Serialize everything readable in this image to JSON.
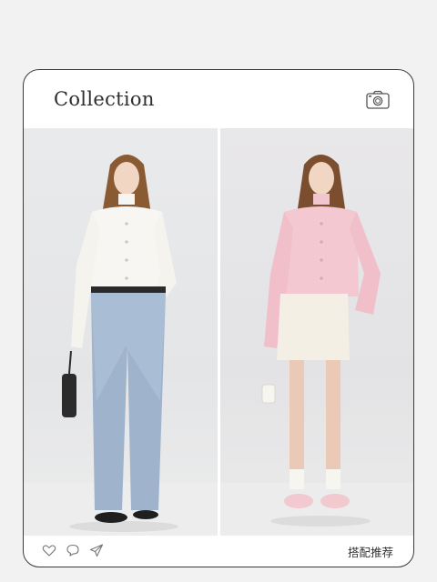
{
  "header": {
    "title": "Collection",
    "camera_icon": "camera-icon"
  },
  "gallery": {
    "photos": [
      {
        "name": "look-white-blouse-jeans",
        "icon": "photo"
      },
      {
        "name": "look-pink-blouse-skirt",
        "icon": "photo"
      }
    ]
  },
  "footer": {
    "icons": [
      "heart-icon",
      "comment-icon",
      "share-icon"
    ],
    "label": "搭配推荐"
  },
  "colors": {
    "background": "#f2f2f2",
    "card": "#ffffff",
    "border": "#3a3a3a",
    "text": "#2e2e2e"
  }
}
